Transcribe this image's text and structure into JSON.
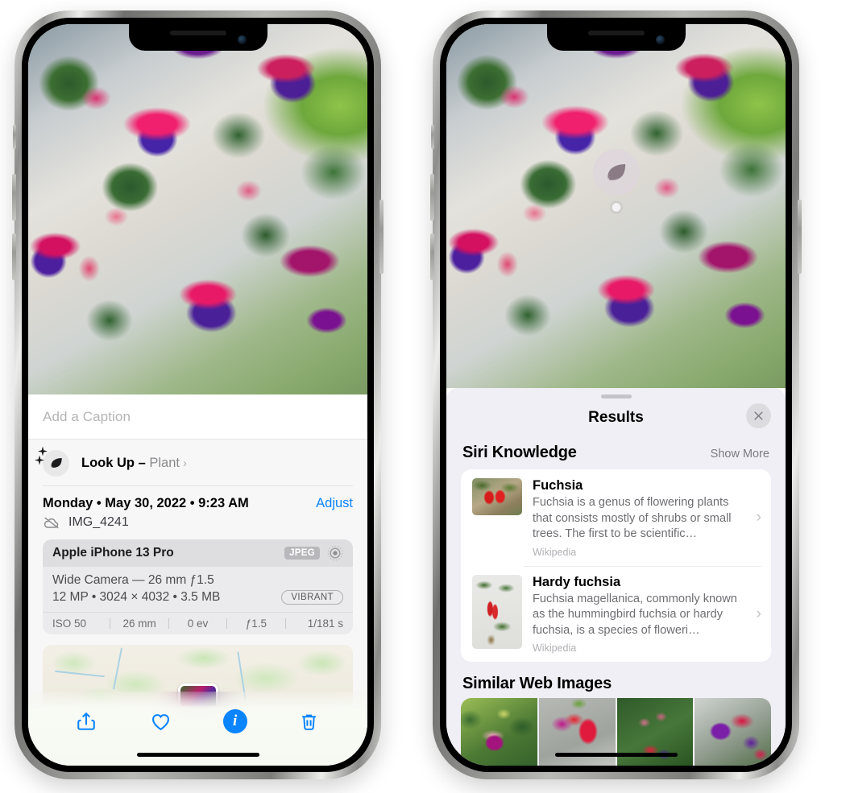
{
  "left_phone": {
    "caption": {
      "placeholder": "Add a Caption",
      "value": ""
    },
    "lookup": {
      "label": "Look Up",
      "dash": " – ",
      "subject": "Plant",
      "chevron": "›",
      "icon": "leaf-icon"
    },
    "date_row": {
      "date": "Monday • May 30, 2022 • 9:23 AM",
      "adjust_label": "Adjust"
    },
    "file_row": {
      "filename": "IMG_4241",
      "icon": "cloud-slash-icon"
    },
    "exif": {
      "device": "Apple iPhone 13 Pro",
      "format_badge": "JPEG",
      "hdr_icon": "hdr-ring-icon",
      "lens": "Wide Camera — 26 mm ƒ1.5",
      "size_line": "12 MP • 3024 × 4032 • 3.5 MB",
      "style_pill": "VIBRANT",
      "stats": [
        "ISO 50",
        "26 mm",
        "0 ev",
        "ƒ1.5",
        "1/181 s"
      ]
    },
    "toolbar": [
      {
        "name": "share-button",
        "icon": "share-icon"
      },
      {
        "name": "favorite-button",
        "icon": "heart-icon"
      },
      {
        "name": "info-button",
        "icon": "info-sparkle-icon"
      },
      {
        "name": "delete-button",
        "icon": "trash-icon"
      }
    ]
  },
  "right_phone": {
    "badge": {
      "icon": "leaf-icon"
    },
    "sheet": {
      "title": "Results",
      "close_icon": "close-icon"
    },
    "siri_knowledge": {
      "section_title": "Siri Knowledge",
      "show_more": "Show More",
      "items": [
        {
          "title": "Fuchsia",
          "description": "Fuchsia is a genus of flowering plants that consists mostly of shrubs or small trees. The first to be scientific…",
          "source": "Wikipedia",
          "chevron": "›"
        },
        {
          "title": "Hardy fuchsia",
          "description": "Fuchsia magellanica, commonly known as the hummingbird fuchsia or hardy fuchsia, is a species of floweri…",
          "source": "Wikipedia",
          "chevron": "›"
        }
      ]
    },
    "similar_web_images": {
      "section_title": "Similar Web Images",
      "count": 4
    }
  },
  "colors": {
    "accent_blue": "#0a84ff",
    "sheet_bg": "#f0eff5",
    "info_bg": "#f7f7f7",
    "exif_bg": "#ebebed"
  }
}
